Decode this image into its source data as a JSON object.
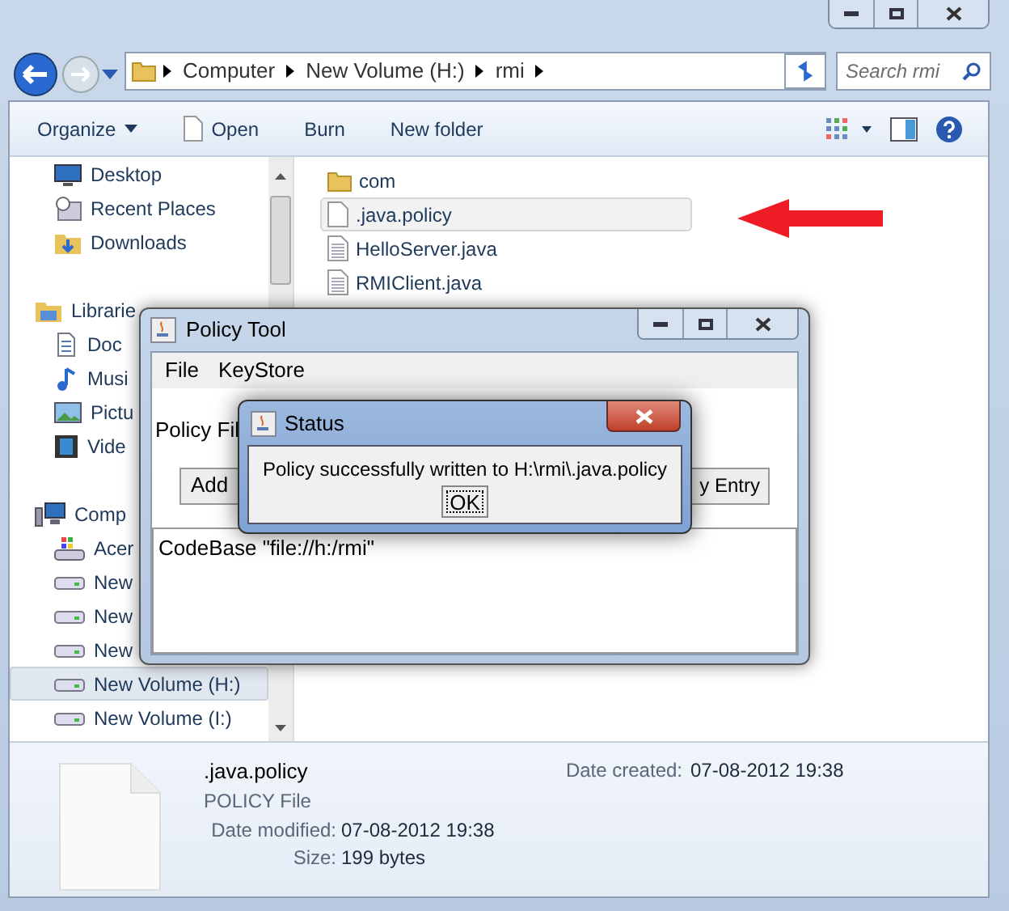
{
  "explorer": {
    "address": {
      "crumbs": [
        "Computer",
        "New Volume (H:)",
        "rmi"
      ]
    },
    "search": {
      "placeholder": "Search rmi"
    },
    "toolbar": [
      {
        "label": "Organize",
        "kind": "menu"
      },
      {
        "label": "Open",
        "kind": "open"
      },
      {
        "label": "Burn",
        "kind": "plain"
      },
      {
        "label": "New folder",
        "kind": "plain"
      }
    ],
    "sidebar": [
      {
        "label": "Desktop",
        "kind": "desktop",
        "selected": false
      },
      {
        "label": "Recent Places",
        "kind": "recent",
        "selected": false
      },
      {
        "label": "Downloads",
        "kind": "downloads",
        "selected": false
      },
      {
        "label": "Librarie",
        "kind": "libraries",
        "selected": false,
        "children": [
          {
            "label": "Doc",
            "kind": "documents",
            "selected": false
          },
          {
            "label": "Musi",
            "kind": "music",
            "selected": false
          },
          {
            "label": "Pictu",
            "kind": "pictures",
            "selected": false
          },
          {
            "label": "Vide",
            "kind": "videos",
            "selected": false
          }
        ]
      },
      {
        "label": "Comp",
        "kind": "computer",
        "selected": false,
        "children": [
          {
            "label": "Acer",
            "kind": "system-drive",
            "selected": false
          },
          {
            "label": "New",
            "kind": "drive",
            "selected": false
          },
          {
            "label": "New",
            "kind": "drive",
            "selected": false
          },
          {
            "label": "New",
            "kind": "drive",
            "selected": false
          },
          {
            "label": "New Volume (H:)",
            "kind": "drive",
            "selected": true
          },
          {
            "label": "New Volume (I:)",
            "kind": "drive",
            "selected": false
          }
        ]
      }
    ],
    "files": [
      {
        "name": "com",
        "kind": "folder",
        "selected": false
      },
      {
        "name": ".java.policy",
        "kind": "file",
        "selected": true
      },
      {
        "name": "HelloServer.java",
        "kind": "text",
        "selected": false
      },
      {
        "name": "RMIClient.java",
        "kind": "text",
        "selected": false
      }
    ],
    "details": {
      "name": ".java.policy",
      "type": "POLICY File",
      "date_modified_label": "Date modified:",
      "date_modified": "07-08-2012 19:38",
      "size_label": "Size:",
      "size": "199 bytes",
      "date_created_label": "Date created:",
      "date_created": "07-08-2012 19:38"
    }
  },
  "policy_tool": {
    "title": "Policy Tool",
    "menu": [
      "File",
      "KeyStore"
    ],
    "policy_file_label": "Policy Fil",
    "buttons": [
      "Add",
      "y Entry"
    ],
    "entries": [
      "CodeBase \"file://h:/rmi\""
    ]
  },
  "status_dialog": {
    "title": "Status",
    "message": "Policy successfully written to H:\\rmi\\.java.policy",
    "button": "OK"
  }
}
